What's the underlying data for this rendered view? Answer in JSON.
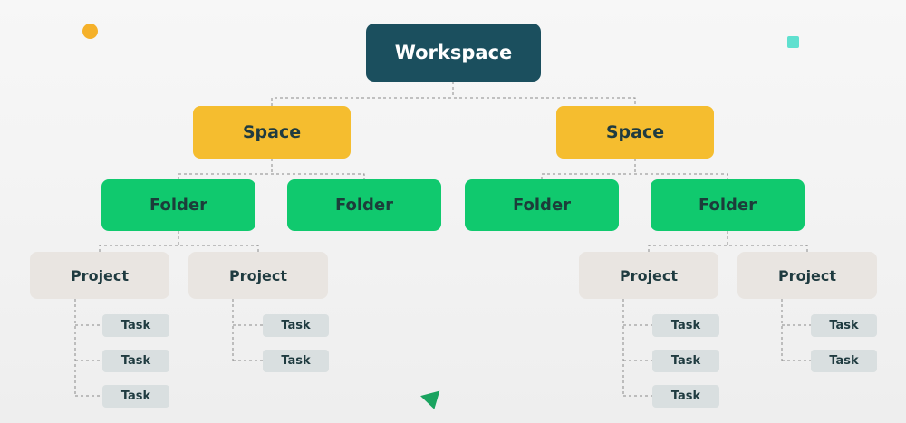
{
  "colors": {
    "workspace": "#1b4f5e",
    "space": "#f5bd2f",
    "folder": "#10c96e",
    "project": "#e9e5e1",
    "task": "#d9dfe0",
    "connector": "#8a8a8a"
  },
  "decorations": [
    "orange-circle",
    "cyan-square",
    "green-triangle"
  ],
  "hierarchy": {
    "workspace": "Workspace",
    "spaces": [
      {
        "label": "Space",
        "folders": [
          {
            "label": "Folder",
            "projects": [
              {
                "label": "Project",
                "tasks": [
                  "Task",
                  "Task",
                  "Task"
                ]
              },
              {
                "label": "Project",
                "tasks": [
                  "Task",
                  "Task"
                ]
              }
            ]
          },
          {
            "label": "Folder",
            "projects": []
          }
        ]
      },
      {
        "label": "Space",
        "folders": [
          {
            "label": "Folder",
            "projects": []
          },
          {
            "label": "Folder",
            "projects": [
              {
                "label": "Project",
                "tasks": [
                  "Task",
                  "Task",
                  "Task"
                ]
              },
              {
                "label": "Project",
                "tasks": [
                  "Task",
                  "Task"
                ]
              }
            ]
          }
        ]
      }
    ]
  }
}
